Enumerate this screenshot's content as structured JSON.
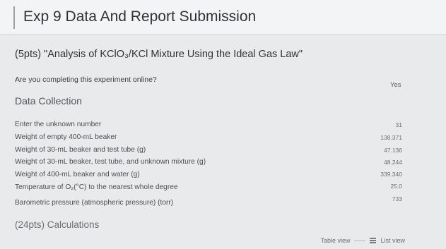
{
  "page": {
    "title": "Exp 9 Data And Report Submission"
  },
  "section": {
    "heading": "(5pts) \"Analysis of KClO₃/KCl Mixture Using the Ideal Gas Law\"",
    "question": "Are you completing this experiment online?",
    "answer": "Yes"
  },
  "data_collection": {
    "heading": "Data Collection",
    "rows": [
      {
        "label": "Enter the unknown number",
        "value": "31"
      },
      {
        "label": "Weight of empty 400-mL beaker",
        "value": "138.371"
      },
      {
        "label": "Weight of 30-mL beaker and test tube (g)",
        "value": "47.136"
      },
      {
        "label": "Weight of 30-mL beaker, test tube, and unknown mixture (g)",
        "value": "48.244"
      },
      {
        "label": "Weight of 400-mL beaker and water (g)",
        "value": "339.340"
      },
      {
        "label": "Temperature of O₂(°C) to the nearest whole degree",
        "value": "25.0"
      },
      {
        "label": "Barometric pressure (atmospheric pressure) (torr)",
        "value": "733"
      }
    ]
  },
  "calculations": {
    "heading": "(24pts) Calculations"
  },
  "footer": {
    "table_view": "Table view",
    "list_view": "List view",
    "list_icon": "list-icon"
  }
}
